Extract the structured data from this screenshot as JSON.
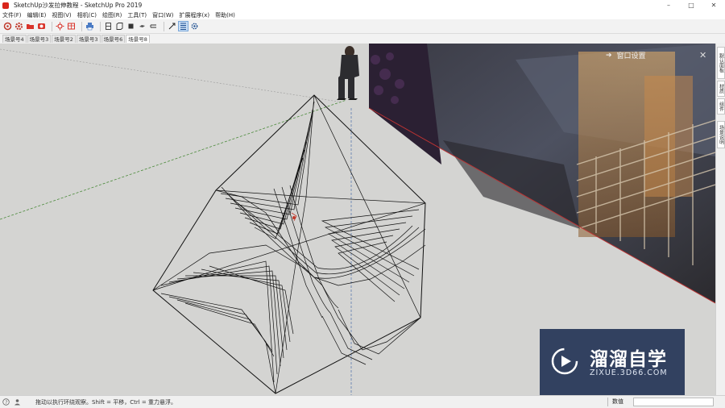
{
  "window": {
    "title": "SketchUp沙发拉伸教程 - SketchUp Pro 2019",
    "minimize_label": "–",
    "maximize_label": "□",
    "close_label": "✕"
  },
  "menu": {
    "items": [
      "文件(F)",
      "编辑(E)",
      "视图(V)",
      "相机(C)",
      "绘图(R)",
      "工具(T)",
      "窗口(W)",
      "扩展程序(x)",
      "帮助(H)"
    ]
  },
  "toolbar": {
    "icons": [
      "orbit-icon",
      "gear-icon",
      "folder-icon",
      "camera-icon",
      "sun-icon",
      "table-icon",
      "print-icon",
      "view-front-icon",
      "view-back-icon",
      "view-top-icon",
      "view-left-icon",
      "view-right-icon",
      "axes-icon",
      "layers-icon",
      "settings-icon"
    ]
  },
  "scenes": {
    "tabs": [
      "场景号4",
      "场景号3",
      "场景号2",
      "场景号3",
      "场景号6",
      "场景号8"
    ],
    "active_index": 5
  },
  "overlay": {
    "window_settings_label": "窗口设置",
    "close_label": "✕"
  },
  "right_panel": {
    "tabs": [
      "默认面板",
      "材质",
      "组件",
      "场景说明"
    ]
  },
  "status": {
    "hint": "拖动以执行环绕观察。Shift = 平移，Ctrl = 重力悬浮。",
    "measurement_label": "数值",
    "measurement_value": ""
  },
  "watermark": {
    "title": "溜溜自学",
    "url": "ZIXUE.3D66.COM"
  },
  "colors": {
    "viewport_bg": "#d4d4d2",
    "wire": "#111111",
    "watermark_bg": "#24345a"
  }
}
